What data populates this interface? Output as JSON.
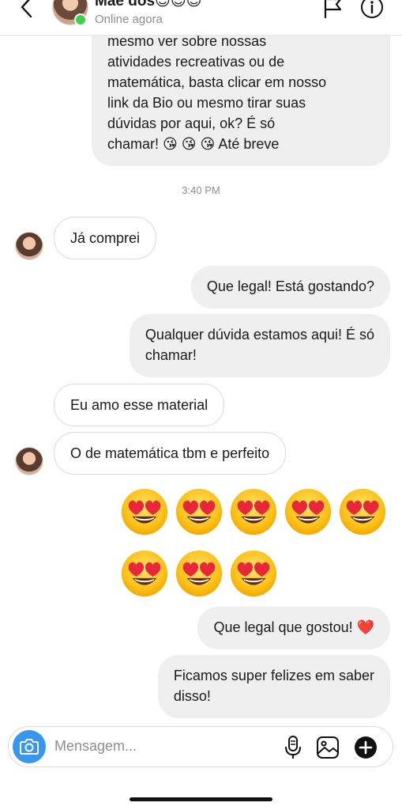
{
  "header": {
    "contact_name": "Mãe dos😊😊😊",
    "status": "Online agora"
  },
  "messages": {
    "m1": [
      "mesmo  ver sobre nossas",
      "atividades recreativas ou de",
      "matemática, basta clicar em nosso",
      "link da Bio ou mesmo tirar suas",
      "dúvidas por aqui, ok?  É só",
      "chamar! 😘 😘 😘  Até breve"
    ],
    "time": "3:40 PM",
    "m2": "Já comprei",
    "m3": "Que legal! Está gostando?",
    "m4": [
      "Qualquer dúvida estamos aqui! É só",
      "chamar!"
    ],
    "m5": "Eu amo esse material",
    "m6": "O de matemática tbm e perfeito",
    "emoji_reaction": "😍😍😍😍😍😍😍😍",
    "m7": "Que legal que gostou! ❤️",
    "m8": [
      "Ficamos super felizes em saber",
      "disso!"
    ]
  },
  "composer": {
    "placeholder": "Mensagem..."
  },
  "icons": {
    "back": "chevron-left-icon",
    "flag": "flag-icon",
    "info": "info-icon",
    "camera": "camera-icon",
    "mic": "microphone-icon",
    "gallery": "image-icon",
    "add": "plus-circle-icon"
  },
  "colors": {
    "online": "#3ecf4c",
    "camera_button": "#3797f0",
    "bubble_gray": "#efefef"
  }
}
